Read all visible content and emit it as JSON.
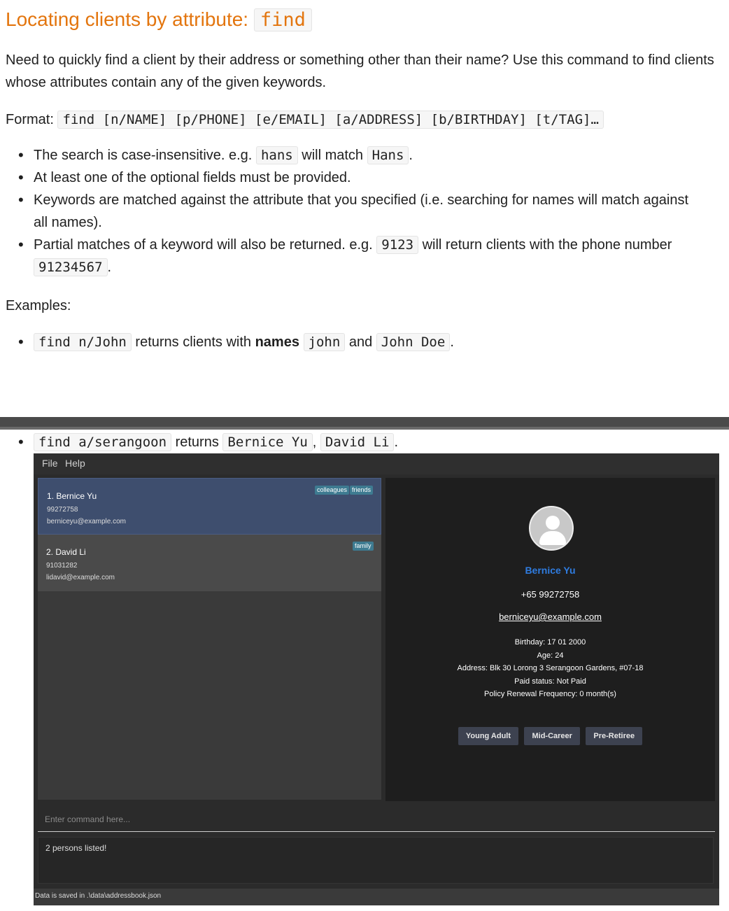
{
  "heading": {
    "text": "Locating clients by attribute:",
    "code": "find"
  },
  "intro": "Need to quickly find a client by their address or something other than their name? Use this command to find clients whose attributes contain any of the given keywords.",
  "format": {
    "label": "Format:",
    "code": "find [n/NAME] [p/PHONE] [e/EMAIL] [a/ADDRESS] [b/BIRTHDAY] [t/TAG]…"
  },
  "notes": {
    "n1": {
      "a": "The search is case-insensitive. e.g.",
      "c1": "hans",
      "b": "will match",
      "c2": "Hans",
      "end": "."
    },
    "n2": "At least one of the optional fields must be provided.",
    "n3": "Keywords are matched against the attribute that you specified (i.e. searching for names will match against all names).",
    "n4": {
      "a": "Partial matches of a keyword will also be returned. e.g.",
      "c1": "9123",
      "b": "will return clients with the phone number",
      "c2": "91234567",
      "end": "."
    }
  },
  "examples_label": "Examples:",
  "example1": {
    "c1": "find n/John",
    "a": "returns clients with",
    "bold": "names",
    "c2": "john",
    "b": "and",
    "c3": "John Doe",
    "end": "."
  },
  "example2": {
    "c1": "find a/serangoon",
    "a": "returns",
    "c2": "Bernice Yu",
    "sep": ",",
    "c3": "David Li",
    "end": "."
  },
  "app": {
    "menu": {
      "file": "File",
      "help": "Help"
    },
    "persons": [
      {
        "index_name": "1.  Bernice Yu",
        "phone": "99272758",
        "email": "berniceyu@example.com",
        "tags": [
          "colleagues",
          "friends"
        ]
      },
      {
        "index_name": "2.  David Li",
        "phone": "91031282",
        "email": "lidavid@example.com",
        "tags": [
          "family"
        ]
      }
    ],
    "detail": {
      "name": "Bernice Yu",
      "phone": "+65 99272758",
      "email": "berniceyu@example.com",
      "birthday": "Birthday: 17 01 2000",
      "age": "Age: 24",
      "address": "Address: Blk 30 Lorong 3 Serangoon Gardens, #07-18",
      "paid": "Paid status: Not Paid",
      "renewal": "Policy Renewal Frequency: 0 month(s)",
      "chips": [
        "Young Adult",
        "Mid-Career",
        "Pre-Retiree"
      ]
    },
    "command_placeholder": "Enter command here...",
    "result": "2 persons listed!",
    "status": "Data is saved in .\\data\\addressbook.json"
  }
}
